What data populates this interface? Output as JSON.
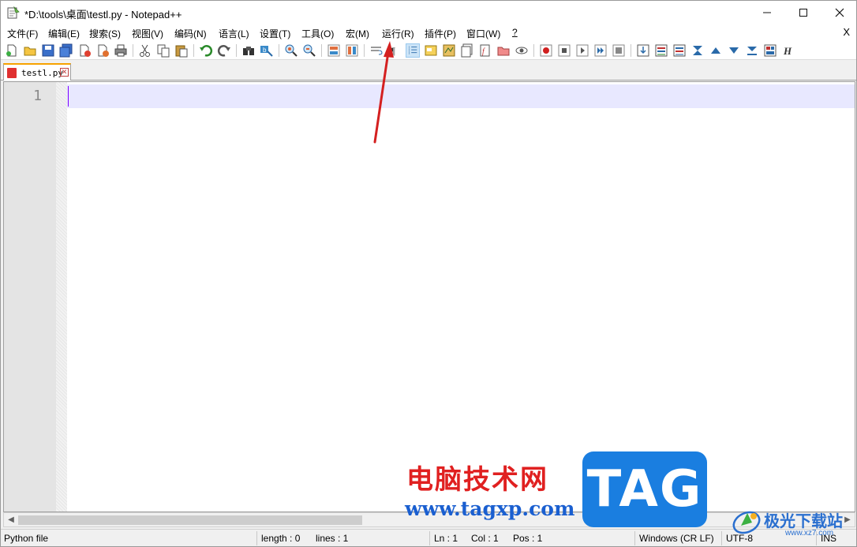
{
  "window": {
    "title": "*D:\\tools\\桌面\\testl.py - Notepad++",
    "controls": {
      "minimize": "—",
      "maximize": "☐",
      "close": "✕"
    }
  },
  "menubar": {
    "items": [
      {
        "label": "文件(F)"
      },
      {
        "label": "编辑(E)"
      },
      {
        "label": "搜索(S)"
      },
      {
        "label": "视图(V)"
      },
      {
        "label": "编码(N)"
      },
      {
        "label": "语言(L)"
      },
      {
        "label": "设置(T)"
      },
      {
        "label": "工具(O)"
      },
      {
        "label": "宏(M)"
      },
      {
        "label": "运行(R)"
      },
      {
        "label": "插件(P)"
      },
      {
        "label": "窗口(W)"
      },
      {
        "label": "?"
      }
    ],
    "close_label": "X"
  },
  "toolbar": {
    "buttons": [
      "new-file-icon",
      "open-file-icon",
      "save-icon",
      "save-all-icon",
      "close-icon",
      "close-all-icon",
      "print-icon",
      "cut-icon",
      "copy-icon",
      "paste-icon",
      "undo-icon",
      "redo-icon",
      "find-icon",
      "replace-icon",
      "zoom-in-icon",
      "zoom-out-icon",
      "sync-vertical-icon",
      "sync-horizontal-icon",
      "word-wrap-icon",
      "show-all-characters-icon",
      "indent-guide-icon",
      "user-defined-language-icon",
      "document-map-icon",
      "document-list-icon",
      "function-list-icon",
      "folder-as-workspace-icon",
      "monitoring-icon",
      "record-macro-icon",
      "stop-recording-icon",
      "playback-macro-icon",
      "run-macro-multiple-icon",
      "save-macro-icon",
      "plugin-1-icon",
      "plugin-2-icon",
      "plugin-3-icon",
      "plugin-4-icon",
      "up-icon",
      "down-icon",
      "plugin-5-icon",
      "plugin-6-icon",
      "hex-icon"
    ]
  },
  "tabs": [
    {
      "label": "testl.py",
      "close": "✕"
    }
  ],
  "editor": {
    "line_numbers": [
      "1"
    ],
    "content": ""
  },
  "statusbar": {
    "file_type": "Python file",
    "length": "length : 0",
    "lines": "lines : 1",
    "ln": "Ln : 1",
    "col": "Col : 1",
    "pos": "Pos : 1",
    "eol": "Windows (CR LF)",
    "encoding": "UTF-8",
    "mode": "INS"
  },
  "watermark": {
    "site_cn": "电脑技术网",
    "site_url": "www.tagxp.com",
    "tag": "TAG",
    "site2_name": "极光下载站",
    "site2_url": "www.xz7.com"
  },
  "colors": {
    "current_line": "#e8e8ff",
    "caret": "#8000ff",
    "arrow": "#d42020",
    "tab_accent": "#f7a200"
  }
}
